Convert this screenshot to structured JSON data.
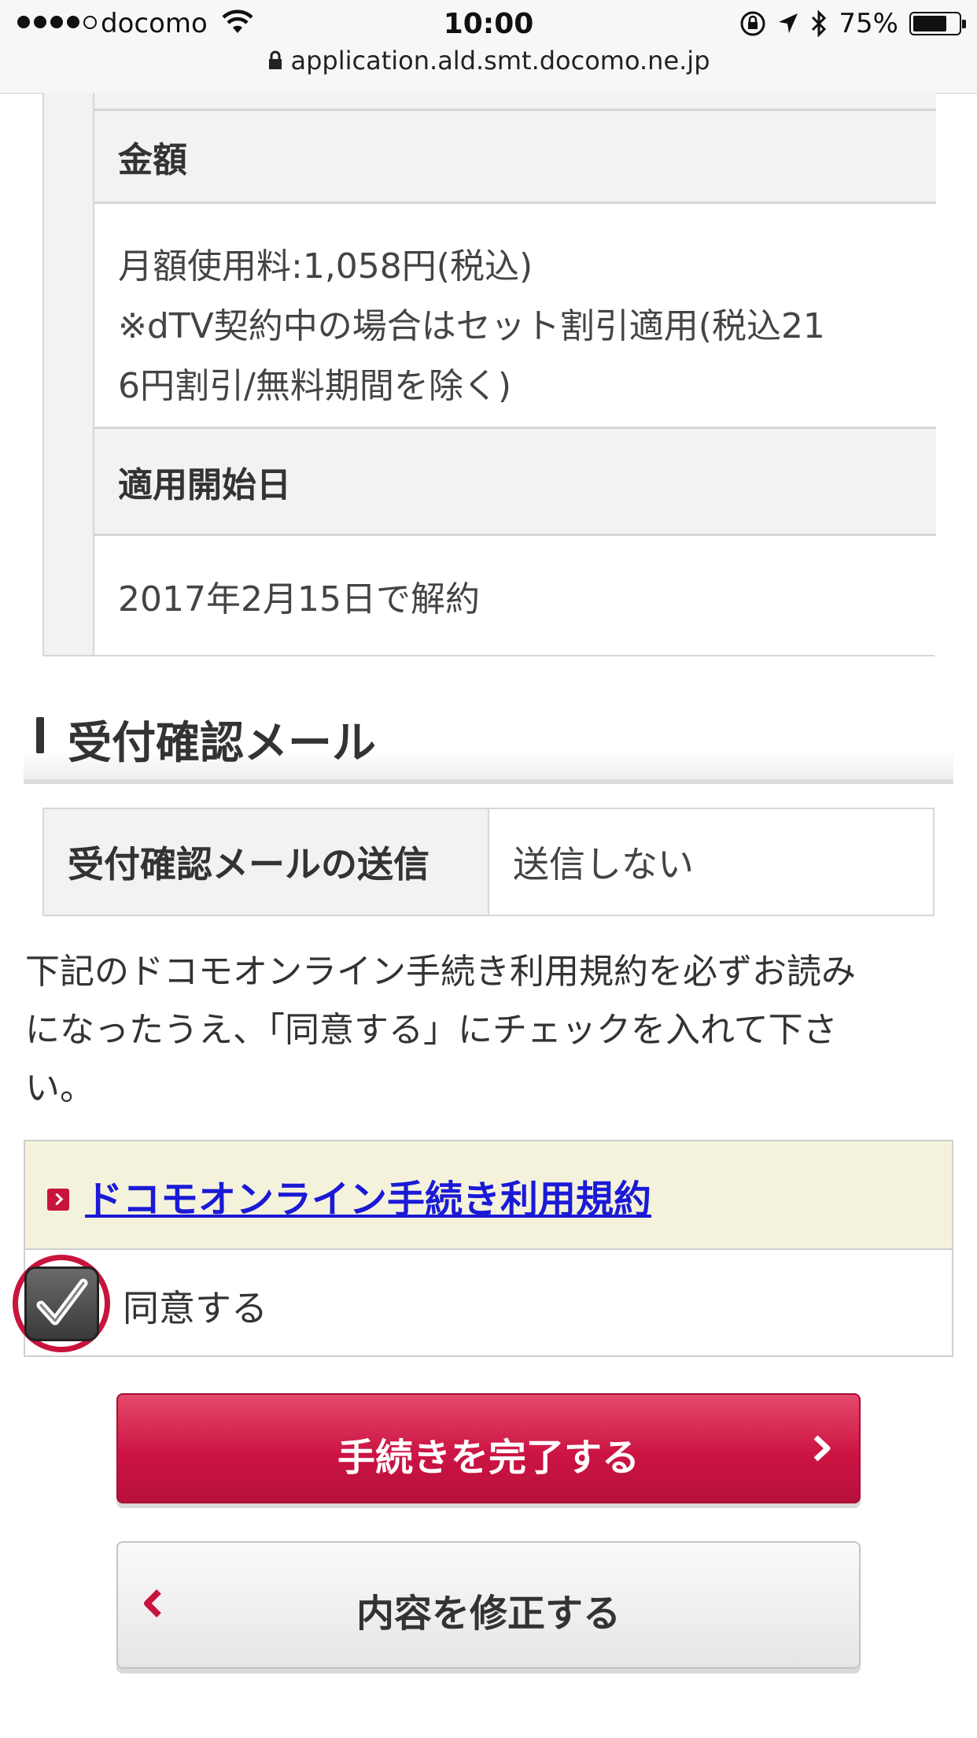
{
  "status_bar": {
    "carrier": "docomo",
    "time": "10:00",
    "battery_percent": "75%",
    "battery_level": 0.75,
    "url": "application.ald.smt.docomo.ne.jp"
  },
  "detail_table": {
    "amount_header": "金額",
    "amount_lines": [
      "月額使用料:1,058円(税込)",
      "※dTV契約中の場合はセット割引適用(税込21",
      "6円割引/無料期間を除く)"
    ],
    "start_date_header": "適用開始日",
    "start_date_value": "2017年2月15日で解約"
  },
  "mail_section": {
    "title": "受付確認メール",
    "row_label": "受付確認メールの送信",
    "row_value": "送信しない"
  },
  "notice": {
    "lines": [
      "下記のドコモオンライン手続き利用規約を必ずお読み",
      "になったうえ、「同意する」にチェックを入れて下さ",
      "い。"
    ]
  },
  "terms": {
    "link_text": "ドコモオンライン手続き利用規約",
    "agree_label": "同意する",
    "agree_checked": true
  },
  "buttons": {
    "complete_label": "手続きを完了する",
    "back_label": "内容を修正する"
  },
  "colors": {
    "accent_red": "#cc1444",
    "link_blue": "#1a1ad6",
    "terms_bg": "#f5f2dc"
  }
}
